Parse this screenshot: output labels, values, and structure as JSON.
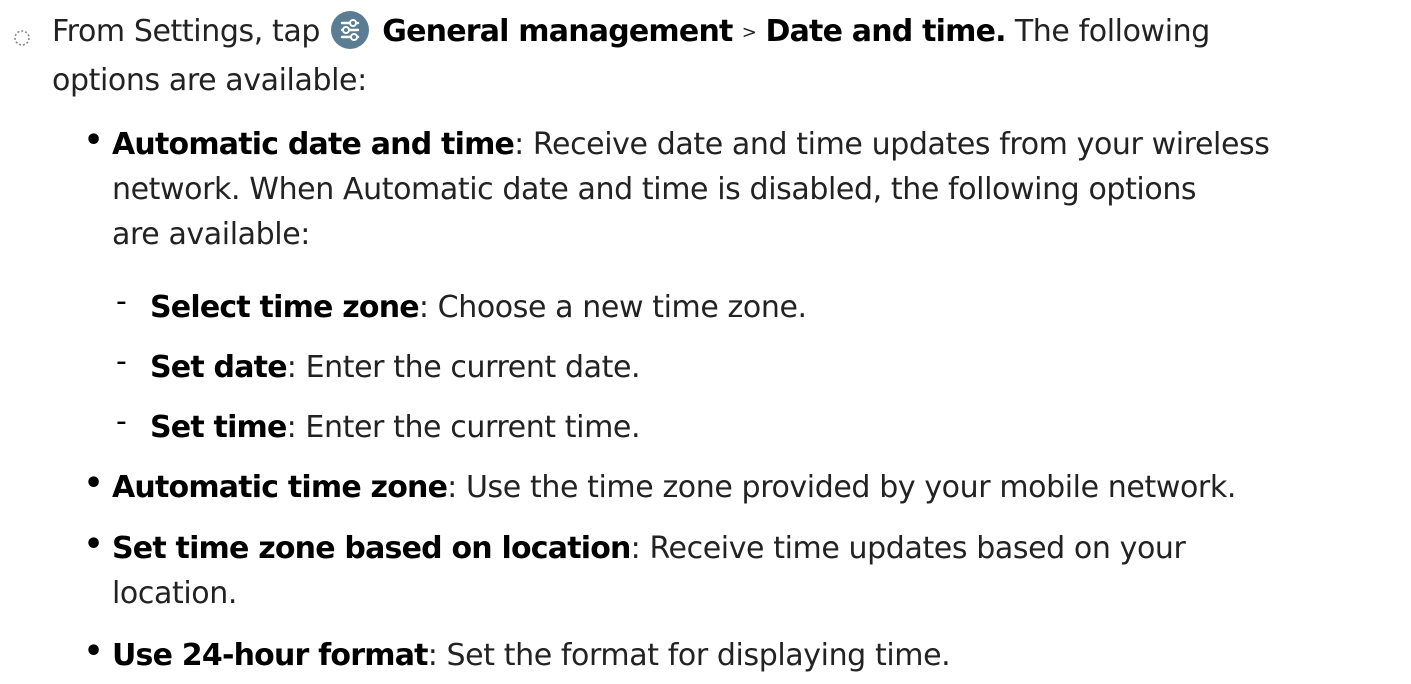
{
  "instructions": {
    "step": {
      "marker_icon": "dotted-circle-icon",
      "prefix": "From Settings, tap",
      "icon": "settings-sliders-icon",
      "icon_color": "#5a7d94",
      "path_first": "General management",
      "separator": ">",
      "path_second": "Date and time.",
      "suffix_line1": " The following",
      "suffix_line2": "options are available:"
    },
    "options": [
      {
        "term": "Automatic date and time",
        "line1": ": Receive date and time updates from your wireless",
        "line2": "network. When Automatic date and time is disabled, the following options",
        "line3": "are available:"
      },
      {
        "term": "Select time zone",
        "text": ": Choose a new time zone."
      },
      {
        "term": "Set date",
        "text": ": Enter the current date."
      },
      {
        "term": "Set time",
        "text": ": Enter the current time."
      },
      {
        "term": "Automatic time zone",
        "text": ": Use the time zone provided by your mobile network."
      },
      {
        "term": "Set time zone based on location",
        "line1": ": Receive time updates based on your",
        "line2": "location."
      },
      {
        "term": "Use 24-hour format",
        "text": ": Set the format for displaying time."
      }
    ]
  }
}
